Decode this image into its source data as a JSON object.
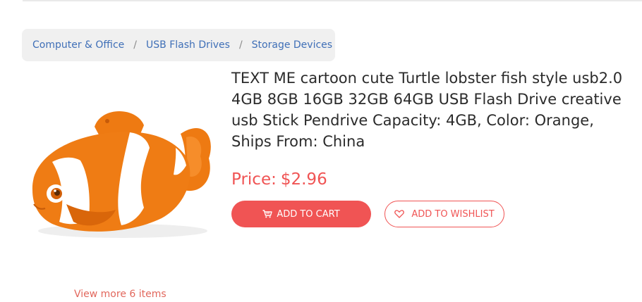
{
  "breadcrumb": {
    "items": [
      {
        "label": "Computer & Office"
      },
      {
        "label": "USB Flash Drives"
      },
      {
        "label": "Storage Devices"
      }
    ],
    "separator": "/"
  },
  "product": {
    "title": "TEXT ME cartoon cute Turtle lobster fish style usb2.0 4GB 8GB 16GB 32GB 64GB USB Flash Drive creative usb Stick Pendrive Capacity: 4GB, Color: Orange, Ships From: China",
    "price_label": "Price:",
    "price_value": "$2.96",
    "image": "clownfish-usb-drive"
  },
  "actions": {
    "add_to_cart": "ADD TO CART",
    "add_to_wishlist": "ADD TO WISHLIST"
  },
  "footer": {
    "view_more": "View more 6 items"
  },
  "colors": {
    "accent": "#f05454",
    "link": "#3f6fb7",
    "breadcrumb_bg": "#f0f0f0"
  }
}
